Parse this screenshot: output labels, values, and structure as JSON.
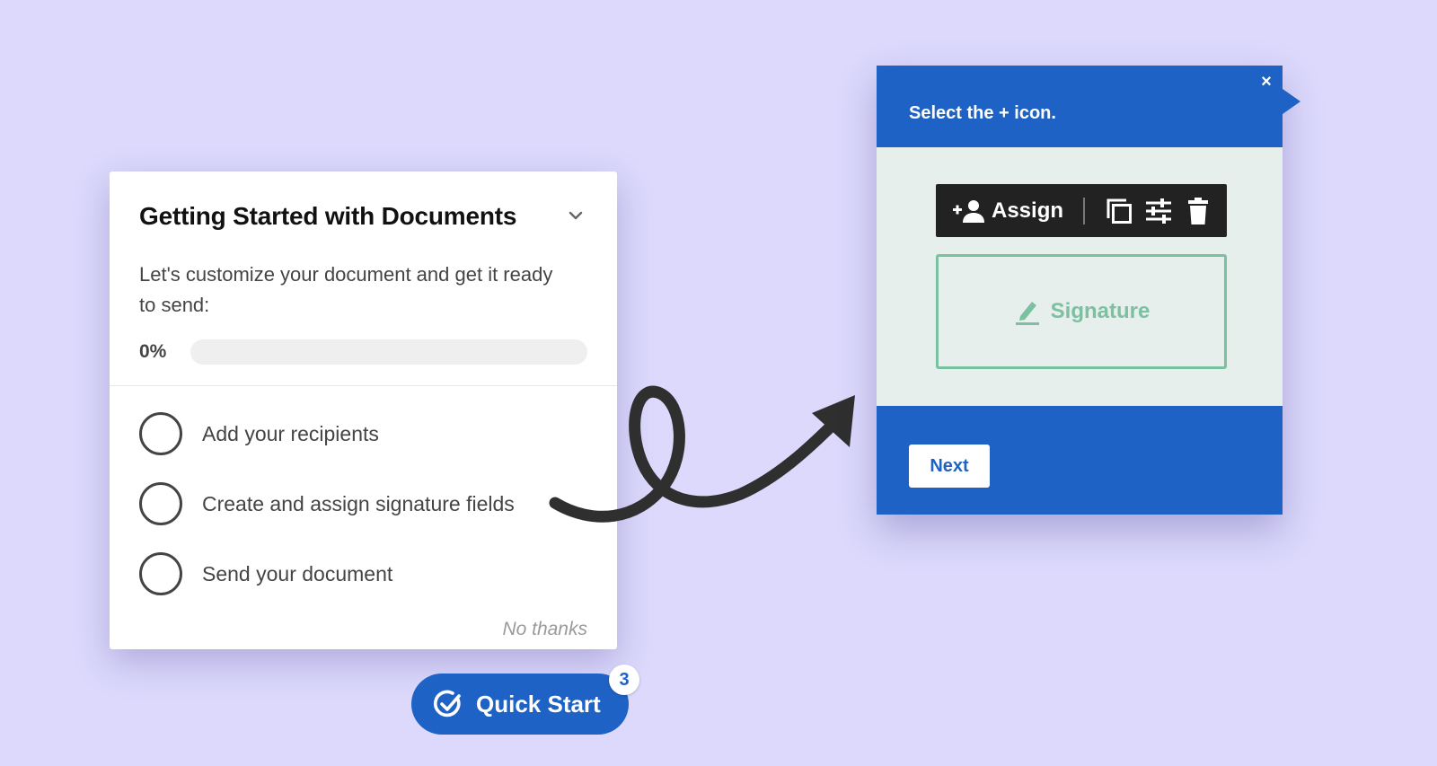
{
  "checklist": {
    "title": "Getting Started with Documents",
    "description": "Let's customize your document and get it ready to send:",
    "progress_label": "0%",
    "progress_value": 0,
    "tasks": [
      {
        "label": "Add your recipients"
      },
      {
        "label": "Create and assign signature fields"
      },
      {
        "label": "Send your document"
      }
    ],
    "dismiss_label": "No thanks"
  },
  "quick_start": {
    "label": "Quick Start",
    "badge": "3"
  },
  "tooltip": {
    "title": "Select the + icon.",
    "close_glyph": "×",
    "toolbar": {
      "assign_label": "Assign",
      "icons": [
        "add-person-icon",
        "copy-icon",
        "sliders-icon",
        "trash-icon"
      ]
    },
    "field_label": "Signature",
    "next_label": "Next"
  },
  "colors": {
    "background": "#dcd9fc",
    "brand_blue": "#1f62c6",
    "signature_green": "#7cc0a2",
    "toolbar_dark": "#222222"
  }
}
